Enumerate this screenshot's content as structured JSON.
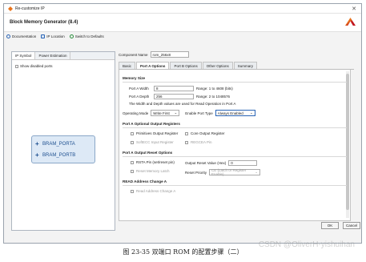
{
  "window": {
    "title": "Re-customize IP",
    "close_glyph": "✕"
  },
  "header": {
    "title": "Block Memory Generator (8.4)"
  },
  "toolbar": {
    "documentation": "Documentation",
    "ip_location": "IP Location",
    "switch_defaults": "Switch to Defaults"
  },
  "left": {
    "tabs": [
      "IP Symbol",
      "Power Estimation"
    ],
    "show_disabled": "Show disabled ports",
    "ports": [
      "BRAM_PORTA",
      "BRAM_PORTB"
    ]
  },
  "component": {
    "label": "Component Name",
    "value": "rom_256x8"
  },
  "tabs": [
    "Basic",
    "Port A Options",
    "Port B Options",
    "Other Options",
    "Summary"
  ],
  "memory_size": {
    "heading": "Memory Size",
    "width_label": "Port A Width",
    "width_value": "8",
    "width_range": "Range: 1 to 4608 (bits)",
    "depth_label": "Port A Depth",
    "depth_value": "256",
    "depth_range": "Range: 2 to 1048576",
    "note": "The Width and Depth values are used for Read Operation in Port A",
    "opmode_label": "Operating Mode",
    "opmode_value": "Write First",
    "enable_label": "Enable Port Type",
    "enable_value": "Always Enabled"
  },
  "optional_regs": {
    "heading": "Port A Optional Output Registers",
    "prim": "Primitives Output Register",
    "core": "Core Output Register",
    "softecc": "SoftECC Input Register",
    "regcea": "REGCEA Pin"
  },
  "reset": {
    "heading": "Port A Output Reset Options",
    "rsta": "RSTA Pin (set/reset pin)",
    "reset_value_label": "Output Reset Value (Hex)",
    "reset_value": "0",
    "latch": "Reset Memory Latch",
    "priority_label": "Reset Priority",
    "priority_value": "CE (Latch or Register Enable)"
  },
  "read_change": {
    "heading": "READ Address Change A",
    "option": "Read Address Change A"
  },
  "buttons": {
    "ok": "OK",
    "cancel": "Cancel"
  },
  "caption": "图 23-35  双端口 ROM 的配置步骤（二）",
  "watermark": "CSDN @OliverH-yishuihan"
}
